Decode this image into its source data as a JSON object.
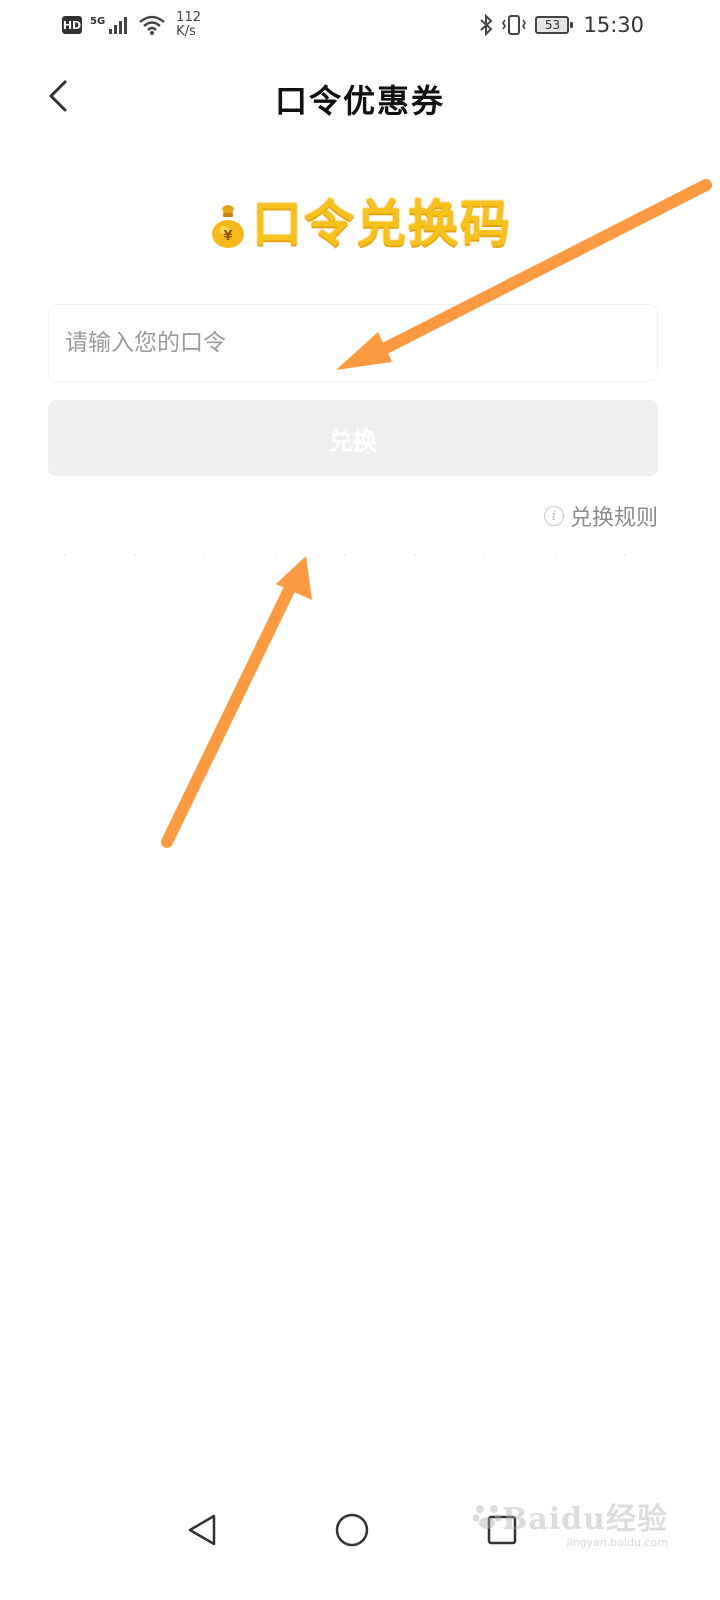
{
  "status_bar": {
    "hd": "HD",
    "network": "5G",
    "speed_value": "112",
    "speed_unit": "K/s",
    "battery": "53",
    "time": "15:30"
  },
  "header": {
    "title": "口令优惠券"
  },
  "banner": {
    "text": "口令兑换码"
  },
  "form": {
    "input_placeholder": "请输入您的口令",
    "input_value": "",
    "redeem_label": "兑换"
  },
  "rules": {
    "label": "兑换规则"
  },
  "watermark": {
    "brand": "Baidu经验",
    "url": "jingyan.baidu.com"
  },
  "colors": {
    "banner_gold": "#f7c21d",
    "arrow_orange": "#fb9a40",
    "button_disabled_bg": "#efefef"
  },
  "icons": {
    "back": "chevron-left-icon",
    "info": "info-icon",
    "nav_back": "triangle-back-icon",
    "nav_home": "circle-home-icon",
    "nav_recent": "square-recent-icon",
    "banner": "money-bag-icon"
  }
}
